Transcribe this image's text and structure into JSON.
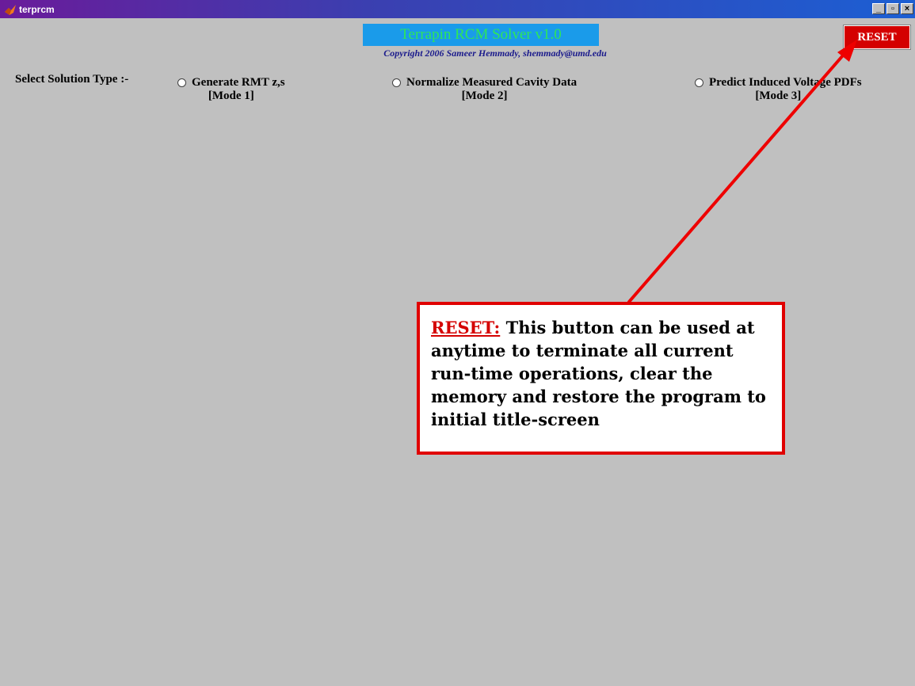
{
  "window": {
    "title": "terprcm",
    "controls": {
      "minimize": "_",
      "maximize": "▫",
      "close": "×"
    }
  },
  "app": {
    "heading": "Terrapin RCM Solver v1.0",
    "copyright": "Copyright 2006 Sameer Hemmady, shemmady@umd.edu",
    "reset_label": "RESET"
  },
  "solution": {
    "label": "Select Solution Type :-",
    "modes": [
      {
        "name": "Generate RMT z,s",
        "tag": "[Mode 1]"
      },
      {
        "name": "Normalize Measured Cavity Data",
        "tag": "[Mode 2]"
      },
      {
        "name": "Predict Induced Voltage PDFs",
        "tag": "[Mode 3]"
      }
    ]
  },
  "annotation": {
    "title": "RESET:",
    "text": "This button can be used at anytime to terminate all current run-time operations, clear the memory and restore the program to initial title-screen"
  },
  "colors": {
    "background": "#c0c0c0",
    "heading_bg": "#1a9bea",
    "heading_text": "#2ee65a",
    "reset_bg": "#d40000",
    "annotation_red": "#e00000"
  },
  "icons": {
    "app": "matlab-icon",
    "radio": "radio-button-icon"
  }
}
